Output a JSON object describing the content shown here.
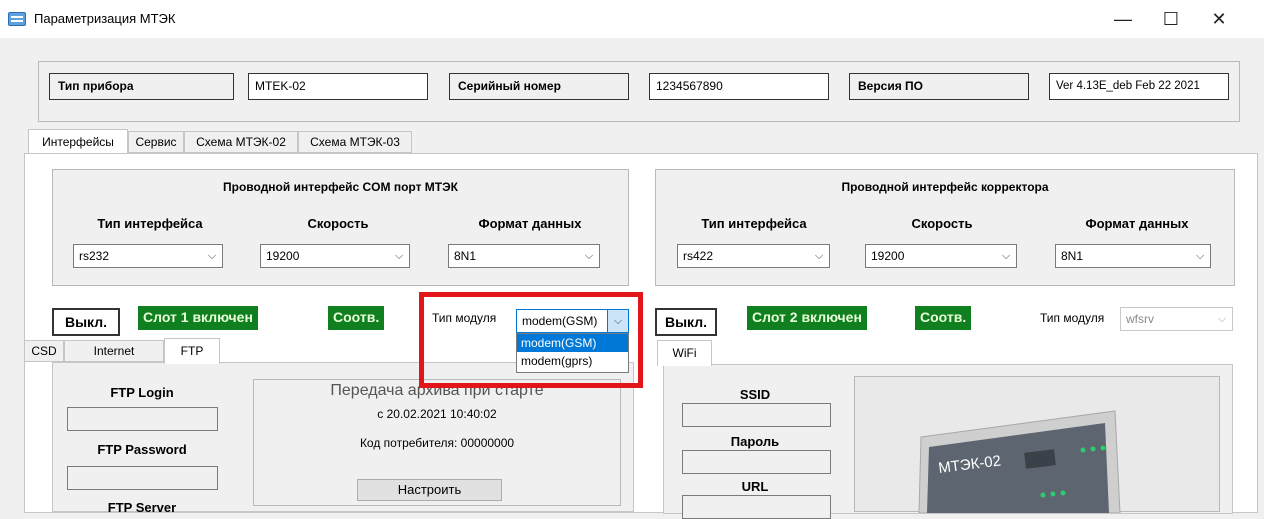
{
  "window": {
    "title": "Параметризация МТЭК",
    "minimize": "—",
    "maximize": "☐",
    "close": "✕"
  },
  "device_info": {
    "device_type_label": "Тип прибора",
    "device_type_value": "MTEK-02",
    "serial_label": "Серийный номер",
    "serial_value": "1234567890",
    "version_label": "Версия ПО",
    "version_value": "Ver 4.13E_deb Feb 22 2021"
  },
  "tabs": [
    {
      "label": "Интерфейсы",
      "active": true
    },
    {
      "label": "Сервис",
      "active": false
    },
    {
      "label": "Схема МТЭК-02",
      "active": false
    },
    {
      "label": "Схема МТЭК-03",
      "active": false
    }
  ],
  "com_port_group": {
    "title": "Проводной интерфейс COM порт МТЭК",
    "interface_type_label": "Тип интерфейса",
    "interface_type_value": "rs232",
    "speed_label": "Скорость",
    "speed_value": "19200",
    "data_format_label": "Формат данных",
    "data_format_value": "8N1"
  },
  "corrector_group": {
    "title": "Проводной интерфейс корректора",
    "interface_type_label": "Тип интерфейса",
    "interface_type_value": "rs422",
    "speed_label": "Скорость",
    "speed_value": "19200",
    "data_format_label": "Формат данных",
    "data_format_value": "8N1"
  },
  "slot1": {
    "off_button": "Выкл.",
    "status": "Слот 1 включен",
    "match": "Соотв.",
    "module_type_label": "Тип модуля",
    "module_type_value": "modem(GSM)",
    "module_options": [
      "modem(GSM)",
      "modem(gprs)"
    ],
    "subtabs": [
      "CSD",
      "Internet",
      "FTP"
    ],
    "active_subtab": "FTP",
    "ftp_login_label": "FTP Login",
    "ftp_password_label": "FTP Password",
    "ftp_server_label": "FTP Server",
    "archive_title": "Передача архива при старте",
    "archive_since": "с 20.02.2021 10:40:02",
    "consumer_code": "Код потребителя: 00000000",
    "configure_button": "Настроить"
  },
  "slot2": {
    "off_button": "Выкл.",
    "status": "Слот 2 включен",
    "match": "Соотв.",
    "module_type_label": "Тип модуля",
    "module_type_value": "wfsrv",
    "subtabs": [
      "WiFi"
    ],
    "active_subtab": "WiFi",
    "ssid_label": "SSID",
    "password_label": "Пароль",
    "url_label": "URL",
    "device_image_label": "МТЭК-02"
  },
  "colors": {
    "status_green": "#0f7f1f",
    "highlight_red": "#e3151b",
    "selection_blue": "#0078d7"
  }
}
